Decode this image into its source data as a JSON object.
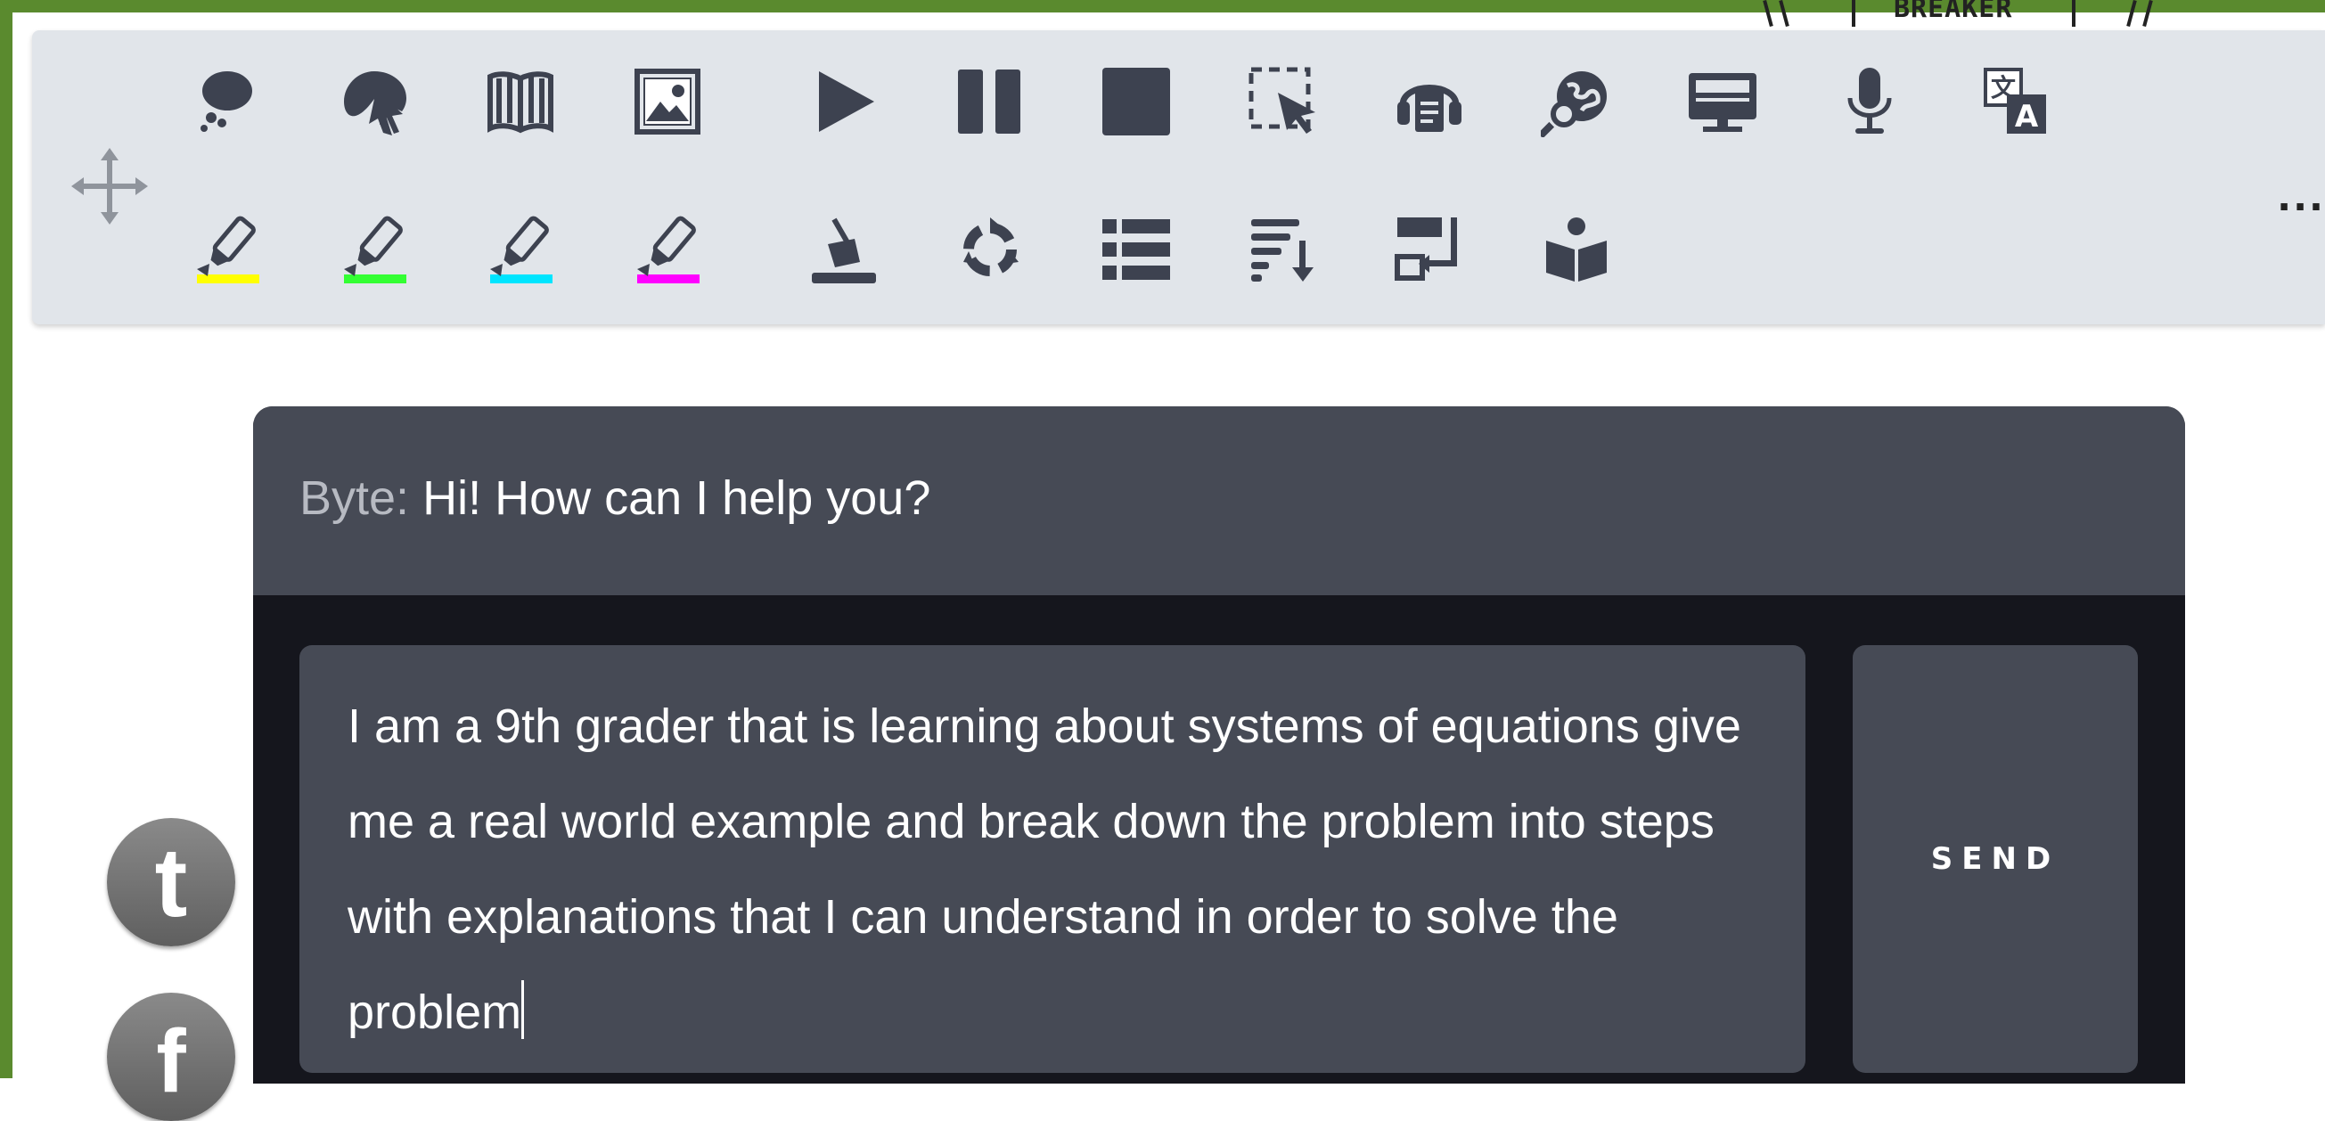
{
  "header_fragment": {
    "text": "BREAKER"
  },
  "toolbar": {
    "row1": [
      {
        "icon": "thought-bubble-icon",
        "label": "Think"
      },
      {
        "icon": "speech-pointer-icon",
        "label": "Click to speak"
      },
      {
        "icon": "book-icon",
        "label": "Read"
      },
      {
        "icon": "image-icon",
        "label": "Picture"
      },
      {
        "icon": "play-icon",
        "label": "Play"
      },
      {
        "icon": "pause-icon",
        "label": "Pause"
      },
      {
        "icon": "stop-icon",
        "label": "Stop"
      },
      {
        "icon": "select-region-icon",
        "label": "Screenshot reader"
      },
      {
        "icon": "audio-document-icon",
        "label": "Audio maker"
      },
      {
        "icon": "web-search-icon",
        "label": "Web search"
      },
      {
        "icon": "monitor-icon",
        "label": "Screen mask"
      },
      {
        "icon": "microphone-icon",
        "label": "Voice note"
      },
      {
        "icon": "translate-icon",
        "label": "Translate"
      }
    ],
    "row2": [
      {
        "icon": "highlighter-yellow-icon",
        "color": "#ffff00"
      },
      {
        "icon": "highlighter-green-icon",
        "color": "#33ff33"
      },
      {
        "icon": "highlighter-cyan-icon",
        "color": "#00e5ff"
      },
      {
        "icon": "highlighter-magenta-icon",
        "color": "#ff00ff"
      },
      {
        "icon": "clear-highlights-icon"
      },
      {
        "icon": "recycle-icon"
      },
      {
        "icon": "list-icon"
      },
      {
        "icon": "sort-list-icon"
      },
      {
        "icon": "collect-icon"
      },
      {
        "icon": "reader-icon"
      }
    ],
    "more_label": "..."
  },
  "chat": {
    "bot_name": "Byte:",
    "bot_message": "Hi! How can I help you?",
    "input_value": "I am a 9th grader that is learning about systems of equations give me a real world example and break down the problem into steps with explanations that I can understand in order to solve the problem",
    "send_label": "SEND"
  },
  "social": {
    "twitter_glyph": "t",
    "facebook_glyph": "f"
  },
  "colors": {
    "toolbar_bg": "#e1e5ea",
    "icon": "#3d4250",
    "panel_header": "#464a55",
    "panel_body": "#15161d",
    "frame_green": "#5a8a2e"
  }
}
